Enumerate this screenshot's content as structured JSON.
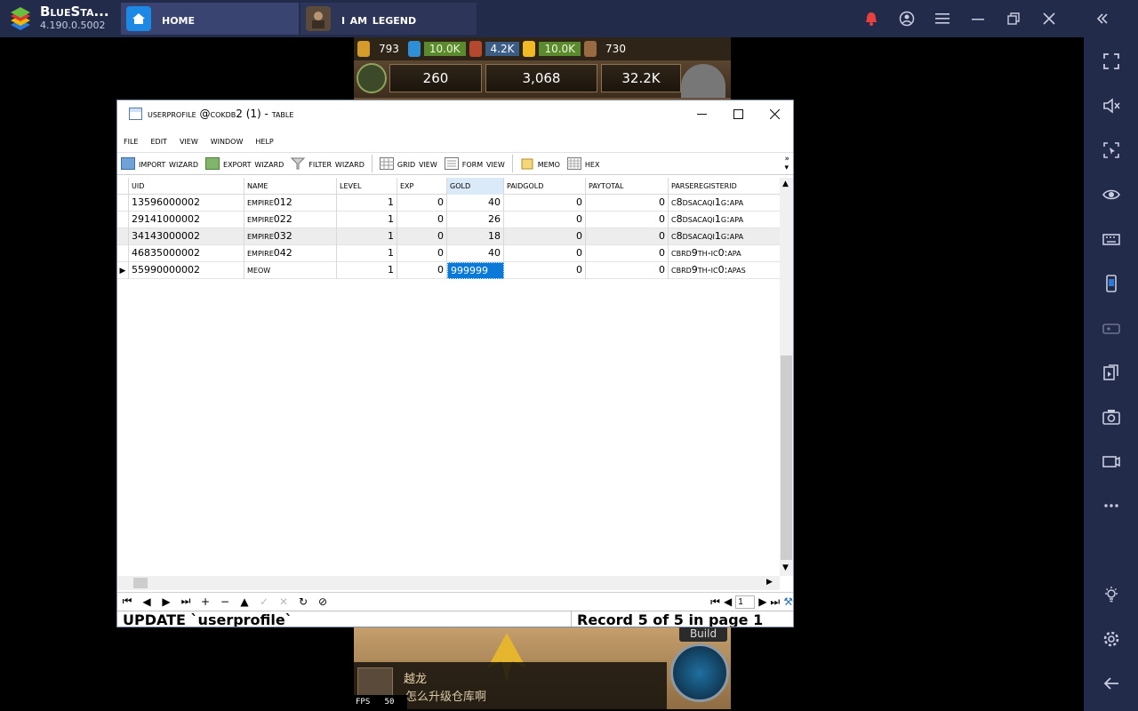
{
  "bluestacks": {
    "brand": "BlueSta...",
    "version": "4.190.0.5002",
    "tabs": [
      {
        "label": "Home"
      },
      {
        "label": "I am legend"
      }
    ]
  },
  "game": {
    "resources": [
      {
        "icon": "wheat-icon",
        "value": "793"
      },
      {
        "icon": "water-icon",
        "value": "10.0K"
      },
      {
        "icon": "crate-icon",
        "value": "4.2K"
      },
      {
        "icon": "lightning-icon",
        "value": "10.0K"
      },
      {
        "icon": "wood-icon",
        "value": "730"
      }
    ],
    "stats": {
      "population": "260",
      "power": "3,068",
      "coins": "32.2K"
    },
    "build_label": "Build",
    "chat_name": "越龙",
    "chat_message": "怎么升级仓库啊",
    "fps_label": "FPS",
    "fps_value": "50"
  },
  "window": {
    "title": "userprofile @cokdb2 (1) - Table",
    "menu": [
      "File",
      "Edit",
      "View",
      "Window",
      "Help"
    ],
    "toolbar": [
      "Import Wizard",
      "Export Wizard",
      "Filter Wizard",
      "Grid View",
      "Form View",
      "Memo",
      "Hex"
    ],
    "columns": [
      "uid",
      "name",
      "level",
      "exp",
      "gold",
      "paidGold",
      "payTotal",
      "parseRegisterId"
    ],
    "rows": [
      [
        "13596000002",
        "Empire012",
        "1",
        "0",
        "40",
        "0",
        "0",
        "c8dsaCAQI1g:APA"
      ],
      [
        "29141000002",
        "Empire022",
        "1",
        "0",
        "26",
        "0",
        "0",
        "c8dsaCAQI1g:APA"
      ],
      [
        "34143000002",
        "Empire032",
        "1",
        "0",
        "18",
        "0",
        "0",
        "c8dsaCAQI1g:APA"
      ],
      [
        "46835000002",
        "Empire042",
        "1",
        "0",
        "40",
        "0",
        "0",
        "cbrd9tH-Ic0:APA"
      ],
      [
        "55990000002",
        "Meow",
        "1",
        "0",
        "999999",
        "0",
        "0",
        "cbrd9tH-Ic0:APAS"
      ]
    ],
    "page_number": "1",
    "status_sql": "UPDATE `userprofile`",
    "status_record": "Record 5 of 5 in page 1"
  }
}
